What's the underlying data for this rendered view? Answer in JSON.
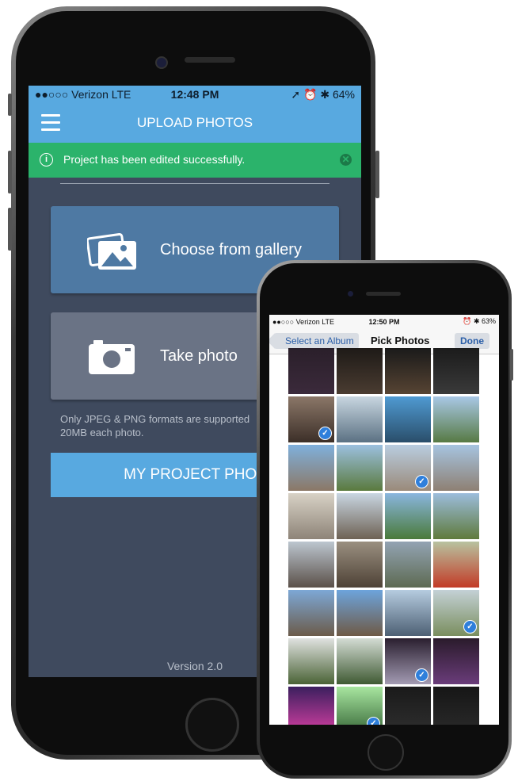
{
  "app": {
    "status": {
      "carrier": "●●○○○ Verizon  LTE",
      "time": "12:48 PM",
      "indicators": "➚ ⏰ ✱ 64%"
    },
    "nav": {
      "title": "UPLOAD PHOTOS",
      "menu_icon": "hamburger-icon"
    },
    "toast": {
      "message": "Project has been edited successfully.",
      "info_icon": "info-icon",
      "close_icon": "close-icon",
      "color": "#2bb36b"
    },
    "gallery_button": {
      "label": "Choose from gallery",
      "icon": "gallery-icon"
    },
    "camera_button": {
      "label": "Take photo",
      "icon": "camera-icon"
    },
    "formats_note": "Only JPEG & PNG formats are supported 20MB each photo.",
    "my_project_button": {
      "label": "MY PROJECT PHOT"
    },
    "version": "Version 2.0",
    "accent": "#58a9e0"
  },
  "picker": {
    "status": {
      "carrier": "●●○○○ Verizon  LTE",
      "time": "12:50 PM",
      "indicators": "⏰ ✱ 63%"
    },
    "nav": {
      "back_label": "Select an Album",
      "title": "Pick Photos",
      "done_label": "Done"
    },
    "photos": [
      {
        "row": 0,
        "col": 0,
        "colors": [
          "#2a1f2a",
          "#3b2a3b"
        ],
        "checked": false
      },
      {
        "row": 0,
        "col": 1,
        "colors": [
          "#1e1a17",
          "#4a3c31"
        ],
        "checked": false
      },
      {
        "row": 0,
        "col": 2,
        "colors": [
          "#1a1a1a",
          "#574433"
        ],
        "checked": false
      },
      {
        "row": 0,
        "col": 3,
        "colors": [
          "#1b1b1b",
          "#3a3a3a"
        ],
        "checked": false
      },
      {
        "row": 1,
        "col": 0,
        "colors": [
          "#8b7768",
          "#3c2f28"
        ],
        "checked": true
      },
      {
        "row": 1,
        "col": 1,
        "colors": [
          "#c8d6e0",
          "#5b7183"
        ],
        "checked": false
      },
      {
        "row": 1,
        "col": 2,
        "colors": [
          "#4f9ad2",
          "#2a4e6a"
        ],
        "checked": false
      },
      {
        "row": 1,
        "col": 3,
        "colors": [
          "#a9c8e6",
          "#577a44"
        ],
        "checked": false
      },
      {
        "row": 2,
        "col": 0,
        "colors": [
          "#7fb0dc",
          "#8b7866"
        ],
        "checked": false
      },
      {
        "row": 2,
        "col": 1,
        "colors": [
          "#9cc0df",
          "#5a7a3e"
        ],
        "checked": false
      },
      {
        "row": 2,
        "col": 2,
        "colors": [
          "#b9cde0",
          "#9a8a7a"
        ],
        "checked": true
      },
      {
        "row": 2,
        "col": 3,
        "colors": [
          "#a6c4e0",
          "#8e8073"
        ],
        "checked": false
      },
      {
        "row": 3,
        "col": 0,
        "colors": [
          "#d8d2c6",
          "#8e8478"
        ],
        "checked": false
      },
      {
        "row": 3,
        "col": 1,
        "colors": [
          "#c9d6e2",
          "#6e6254"
        ],
        "checked": false
      },
      {
        "row": 3,
        "col": 2,
        "colors": [
          "#8ab6de",
          "#4a7a3a"
        ],
        "checked": false
      },
      {
        "row": 3,
        "col": 3,
        "colors": [
          "#9cbddc",
          "#5f7a3c"
        ],
        "checked": false
      },
      {
        "row": 4,
        "col": 0,
        "colors": [
          "#bcc6cf",
          "#5b5049"
        ],
        "checked": false
      },
      {
        "row": 4,
        "col": 1,
        "colors": [
          "#9a8f80",
          "#4e4236"
        ],
        "checked": false
      },
      {
        "row": 4,
        "col": 2,
        "colors": [
          "#93a3b3",
          "#5d6a52"
        ],
        "checked": false
      },
      {
        "row": 4,
        "col": 3,
        "colors": [
          "#b8c2a0",
          "#c23b27"
        ],
        "checked": false
      },
      {
        "row": 5,
        "col": 0,
        "colors": [
          "#7da8d6",
          "#6b5b4a"
        ],
        "checked": false
      },
      {
        "row": 5,
        "col": 1,
        "colors": [
          "#6da4dc",
          "#6e5a46"
        ],
        "checked": false
      },
      {
        "row": 5,
        "col": 2,
        "colors": [
          "#b6cce0",
          "#4d6074"
        ],
        "checked": false
      },
      {
        "row": 5,
        "col": 3,
        "colors": [
          "#c4d1d6",
          "#7a8e5e"
        ],
        "checked": true
      },
      {
        "row": 6,
        "col": 0,
        "colors": [
          "#e0e2e0",
          "#4a6336"
        ],
        "checked": false
      },
      {
        "row": 6,
        "col": 1,
        "colors": [
          "#d4dcd4",
          "#3f5a33"
        ],
        "checked": false
      },
      {
        "row": 6,
        "col": 2,
        "colors": [
          "#2a1f2f",
          "#a39bb3"
        ],
        "checked": true
      },
      {
        "row": 6,
        "col": 3,
        "colors": [
          "#2a1b2b",
          "#6a3c7a"
        ],
        "checked": false
      },
      {
        "row": 7,
        "col": 0,
        "colors": [
          "#3b1f5e",
          "#d23fa1"
        ],
        "checked": false
      },
      {
        "row": 7,
        "col": 1,
        "colors": [
          "#a8e6a0",
          "#3a6a3a"
        ],
        "checked": true
      },
      {
        "row": 7,
        "col": 2,
        "colors": [
          "#1a1a1a",
          "#2e2e2e"
        ],
        "checked": false
      },
      {
        "row": 7,
        "col": 3,
        "colors": [
          "#161616",
          "#2a2a2a"
        ],
        "checked": false
      },
      {
        "row": 8,
        "col": 0,
        "colors": [
          "#333",
          "#444"
        ],
        "checked": false
      },
      {
        "row": 8,
        "col": 1,
        "colors": [
          "#555",
          "#777"
        ],
        "checked": false
      },
      {
        "row": 8,
        "col": 2,
        "colors": [
          "#333",
          "#555"
        ],
        "checked": false
      },
      {
        "row": 8,
        "col": 3,
        "colors": [
          "#444",
          "#666"
        ],
        "checked": false
      }
    ],
    "check_color": "#2f7fdb"
  }
}
